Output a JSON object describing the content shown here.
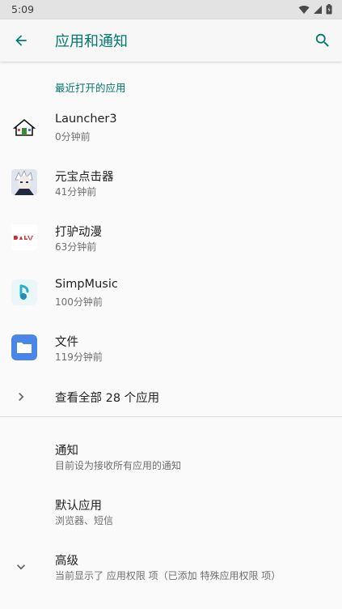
{
  "status_bar": {
    "time": "5:09"
  },
  "app_bar": {
    "title": "应用和通知"
  },
  "recent_section": {
    "header": "最近打开的应用",
    "apps": [
      {
        "name": "Launcher3",
        "time": "0分钟前",
        "icon": "house-icon"
      },
      {
        "name": "元宝点击器",
        "time": "41分钟前",
        "icon": "anime-avatar-icon"
      },
      {
        "name": "打驴动漫",
        "time": "63分钟前",
        "icon": "dalv-logo-icon"
      },
      {
        "name": "SimpMusic",
        "time": "100分钟前",
        "icon": "music-note-icon"
      },
      {
        "name": "文件",
        "time": "119分钟前",
        "icon": "folder-icon"
      }
    ],
    "see_all": "查看全部 28 个应用"
  },
  "preferences": {
    "notifications": {
      "title": "通知",
      "summary": "目前设为接收所有应用的通知"
    },
    "default_apps": {
      "title": "默认应用",
      "summary": "浏览器、短信"
    },
    "advanced": {
      "title": "高级",
      "summary": "当前显示了 应用权限 项（已添加 特殊应用权限 项）"
    }
  },
  "colors": {
    "accent": "#00796b",
    "folder_blue": "#4a86e8"
  }
}
